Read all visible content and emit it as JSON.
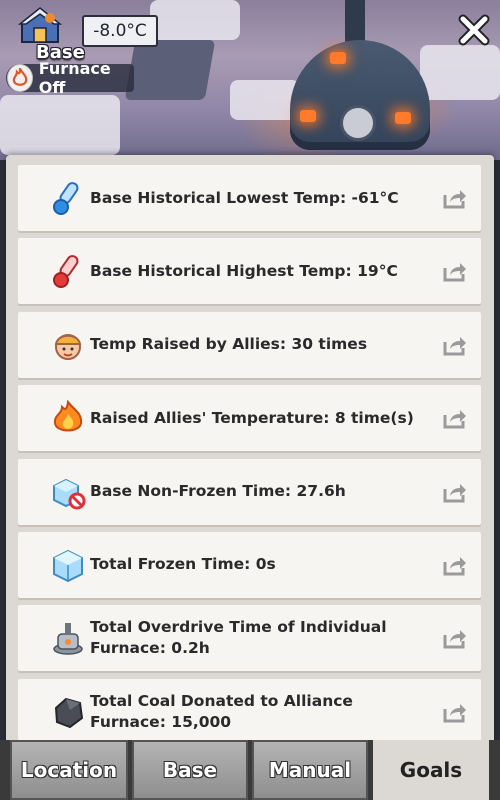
{
  "hud": {
    "base_label": "Base",
    "temperature": "-8.0°C",
    "furnace_status": "Furnace Off"
  },
  "stats": [
    {
      "icon": "thermometer-blue-icon",
      "text": "Base Historical Lowest Temp: -61°C"
    },
    {
      "icon": "thermometer-red-icon",
      "text": "Base Historical Highest Temp: 19°C"
    },
    {
      "icon": "survivor-face-icon",
      "text": "Temp Raised by Allies: 30 times"
    },
    {
      "icon": "fire-icon",
      "text": "Raised Allies' Temperature: 8 time(s)"
    },
    {
      "icon": "ice-cube-no-icon",
      "text": "Base Non-Frozen Time: 27.6h"
    },
    {
      "icon": "ice-cube-icon",
      "text": "Total Frozen Time: 0s"
    },
    {
      "icon": "furnace-icon",
      "text": "Total Overdrive Time of Individual Furnace: 0.2h"
    },
    {
      "icon": "coal-icon",
      "text": "Total Coal Donated to Alliance Furnace: 15,000"
    }
  ],
  "tabs": [
    {
      "label": "Location",
      "active": false
    },
    {
      "label": "Base",
      "active": false
    },
    {
      "label": "Manual",
      "active": false
    },
    {
      "label": "Goals",
      "active": true
    }
  ],
  "colors": {
    "panel": "#dcd8d3",
    "row": "#f7f5f2",
    "tab_active": "#dcd8d3",
    "tab_inactive": "#a3a3a3"
  }
}
